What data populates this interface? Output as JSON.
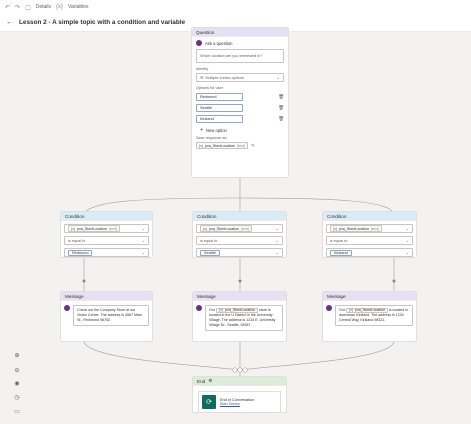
{
  "toolbar": {
    "undo_icon": "undo-icon",
    "redo_icon": "redo-icon",
    "details_label": "Details",
    "variables_label": "Variables"
  },
  "header": {
    "back_icon": "arrow-left-icon",
    "title": "Lesson 2 - A simple topic with a condition and variable"
  },
  "question": {
    "title": "Question",
    "ask_label": "Ask a question",
    "prompt": "Which location are you interested in?",
    "identify_label": "Identify",
    "identify_value": "Multiple choice options",
    "options_label": "Options for user",
    "options": [
      "Redmond",
      "Seattle",
      "Kirkland"
    ],
    "new_option": "New option",
    "save_label": "Save response as",
    "variable_name": "pva_StoreLocation",
    "variable_type": "(text)"
  },
  "conditions": [
    {
      "title": "Condition",
      "variable_name": "pva_StoreLocation",
      "variable_type": "(text)",
      "operator": "is equal to",
      "value": "Redmond"
    },
    {
      "title": "Condition",
      "variable_name": "pva_StoreLocation",
      "variable_type": "(text)",
      "operator": "is equal to",
      "value": "Seattle"
    },
    {
      "title": "Condition",
      "variable_name": "pva_StoreLocation",
      "variable_type": "(text)",
      "operator": "is equal to",
      "value": "Kirkland"
    }
  ],
  "messages": [
    {
      "title": "Message",
      "text": "Check out the Company Store at our Visitor Center. The address is 4567 Main St., Redmond 98752."
    },
    {
      "title": "Message",
      "prefix": "Our",
      "var_tag": "{x}",
      "var_name": "pva_StoreLocation",
      "suffix": "store is located in the U District in the University Village. The address is 1234 E. University Village Dr., Seattle, 94567"
    },
    {
      "title": "Message",
      "prefix": "Our",
      "var_tag": "{x}",
      "var_name": "pva_StoreLocation",
      "suffix": "is located in downtown Kirkland. The address is 1234 Central Way, Kirkland 98321."
    }
  ],
  "end": {
    "title": "End",
    "label": "End of Conversation",
    "link": "Start Survey"
  },
  "zoom_controls": [
    "zoom-in-icon",
    "zoom-out-icon",
    "fit-view-icon",
    "history-icon",
    "minimap-icon"
  ],
  "colors": {
    "question_header": "#e5e0f4",
    "condition_header": "#d9ebf7",
    "end_header": "#dcedd7",
    "bubble": "#6b2d8c"
  }
}
